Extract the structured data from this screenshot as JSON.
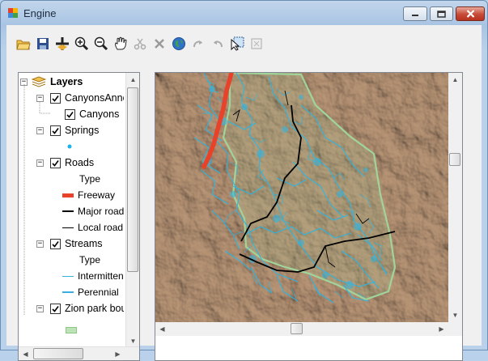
{
  "window": {
    "title": "Engine",
    "icon": "app-icon",
    "controls": [
      "minimize-icon",
      "maximize-icon",
      "close-icon"
    ]
  },
  "toolbar": {
    "tools": [
      {
        "name": "open-icon",
        "enabled": true
      },
      {
        "name": "save-icon",
        "enabled": true
      },
      {
        "name": "add-data-icon",
        "enabled": true
      },
      {
        "name": "zoom-in-icon",
        "enabled": true
      },
      {
        "name": "zoom-out-icon",
        "enabled": true
      },
      {
        "name": "pan-icon",
        "enabled": true
      },
      {
        "name": "cut-icon",
        "enabled": false
      },
      {
        "name": "delete-icon",
        "enabled": false
      },
      {
        "name": "full-extent-icon",
        "enabled": true
      },
      {
        "name": "redo-icon",
        "enabled": false
      },
      {
        "name": "undo-icon",
        "enabled": false
      },
      {
        "name": "select-features-icon",
        "enabled": true
      },
      {
        "name": "clear-selection-icon",
        "enabled": false
      }
    ]
  },
  "toc": {
    "root": "Layers",
    "items": [
      {
        "type": "layer",
        "label": "CanyonsAnno",
        "checked": true
      },
      {
        "type": "sublayer",
        "label": "Canyons",
        "checked": true
      },
      {
        "type": "layer",
        "label": "Springs",
        "checked": true
      },
      {
        "type": "legend",
        "symbol": "point",
        "color": "#1cb3e6",
        "label": ""
      },
      {
        "type": "layer",
        "label": "Roads",
        "checked": true
      },
      {
        "type": "legend-heading",
        "label": "Type"
      },
      {
        "type": "legend",
        "symbol": "line-thick",
        "color": "#e8432a",
        "label": "Freeway"
      },
      {
        "type": "legend",
        "symbol": "line-medium",
        "color": "#000000",
        "label": "Major road"
      },
      {
        "type": "legend",
        "symbol": "line-thin",
        "color": "#000000",
        "label": "Local road"
      },
      {
        "type": "layer",
        "label": "Streams",
        "checked": true
      },
      {
        "type": "legend-heading",
        "label": "Type"
      },
      {
        "type": "legend",
        "symbol": "line-thin",
        "color": "#3aaee0",
        "label": "Intermittent"
      },
      {
        "type": "legend",
        "symbol": "line-medium",
        "color": "#3aaee0",
        "label": "Perennial"
      },
      {
        "type": "layer",
        "label": "Zion park boundary",
        "checked": true
      }
    ]
  },
  "map": {
    "terrain_color": "#c8b09a",
    "stream_color": "#29b6e6",
    "freeway_color": "#e8432a",
    "boundary_color": "#9fd49a",
    "road_color": "#000000"
  }
}
